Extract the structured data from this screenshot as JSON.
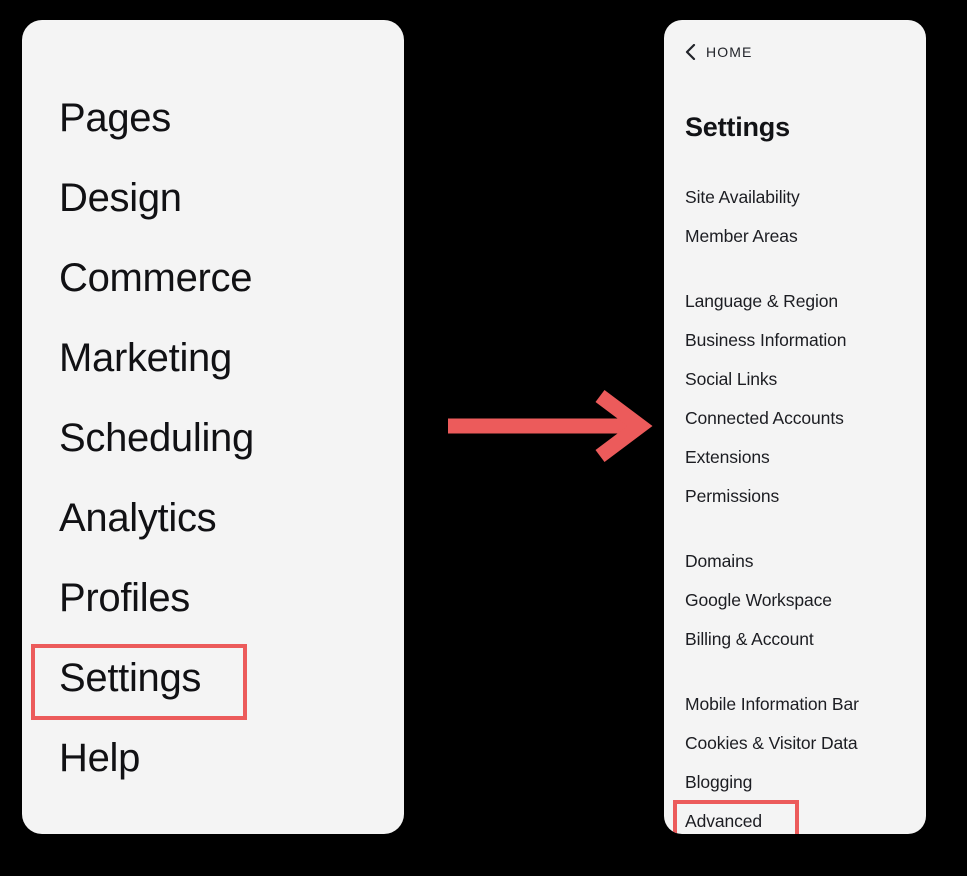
{
  "accent": {
    "highlight_color": "#EC5B5B",
    "arrow_color": "#EC5B5B",
    "panel_bg": "#F4F4F4",
    "page_bg": "#000000",
    "text_color": "#111114"
  },
  "left_panel": {
    "name": "main-navigation-panel",
    "items": [
      {
        "label": "Pages",
        "highlighted": false
      },
      {
        "label": "Design",
        "highlighted": false
      },
      {
        "label": "Commerce",
        "highlighted": false
      },
      {
        "label": "Marketing",
        "highlighted": false
      },
      {
        "label": "Scheduling",
        "highlighted": false
      },
      {
        "label": "Analytics",
        "highlighted": false
      },
      {
        "label": "Profiles",
        "highlighted": false
      },
      {
        "label": "Settings",
        "highlighted": true
      },
      {
        "label": "Help",
        "highlighted": false
      }
    ]
  },
  "arrow": {
    "name": "flow-arrow",
    "direction": "right",
    "color": "#EC5B5B"
  },
  "right_panel": {
    "name": "settings-panel",
    "back_link": {
      "icon": "chevron-left-icon",
      "label": "HOME"
    },
    "heading": "Settings",
    "groups": [
      {
        "items": [
          {
            "label": "Site Availability",
            "highlighted": false
          },
          {
            "label": "Member Areas",
            "highlighted": false
          }
        ]
      },
      {
        "items": [
          {
            "label": "Language & Region",
            "highlighted": false
          },
          {
            "label": "Business Information",
            "highlighted": false
          },
          {
            "label": "Social Links",
            "highlighted": false
          },
          {
            "label": "Connected Accounts",
            "highlighted": false
          },
          {
            "label": "Extensions",
            "highlighted": false
          },
          {
            "label": "Permissions",
            "highlighted": false
          }
        ]
      },
      {
        "items": [
          {
            "label": "Domains",
            "highlighted": false
          },
          {
            "label": "Google Workspace",
            "highlighted": false
          },
          {
            "label": "Billing & Account",
            "highlighted": false
          }
        ]
      },
      {
        "items": [
          {
            "label": "Mobile Information Bar",
            "highlighted": false
          },
          {
            "label": "Cookies & Visitor Data",
            "highlighted": false
          },
          {
            "label": "Blogging",
            "highlighted": false
          },
          {
            "label": "Advanced",
            "highlighted": true
          }
        ]
      }
    ]
  }
}
